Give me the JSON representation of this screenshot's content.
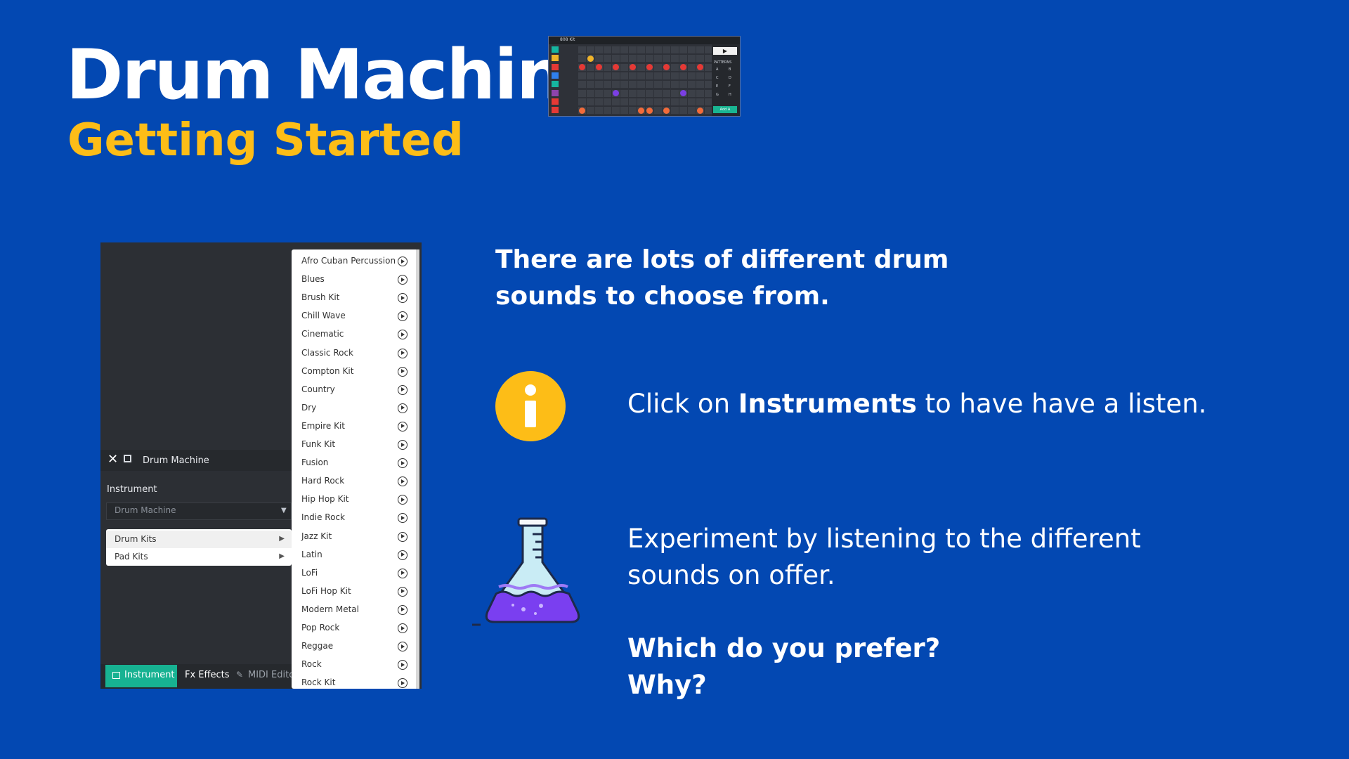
{
  "header": {
    "title": "Drum Machine",
    "subtitle": "Getting Started"
  },
  "thumbnail": {
    "kit_label": "808 Kit",
    "play_glyph": "▶",
    "patterns_label": "PATTERNS",
    "pattern_letters": [
      "A",
      "B",
      "C",
      "D",
      "E",
      "F",
      "G",
      "H"
    ],
    "add_label": "Add A"
  },
  "panel": {
    "close_glyph": "✕",
    "header_title": "Drum Machine",
    "instrument_label": "Instrument",
    "instrument_value": "Drum Machine",
    "select_chevron": "▼",
    "submenu": [
      {
        "label": "Drum Kits",
        "arrow": "▶"
      },
      {
        "label": "Pad Kits",
        "arrow": "▶"
      }
    ],
    "tabs": {
      "instrument": "Instrument",
      "effects": "Fx Effects",
      "midi": "MIDI Editor",
      "midi_icon": "✎"
    },
    "kits": [
      "Afro Cuban Percussion",
      "Blues",
      "Brush Kit",
      "Chill Wave",
      "Cinematic",
      "Classic Rock",
      "Compton Kit",
      "Country",
      "Dry",
      "Empire Kit",
      "Funk Kit",
      "Fusion",
      "Hard Rock",
      "Hip Hop Kit",
      "Indie Rock",
      "Jazz Kit",
      "Latin",
      "LoFi",
      "LoFi Hop Kit",
      "Modern Metal",
      "Pop Rock",
      "Reggae",
      "Rock",
      "Rock Kit"
    ]
  },
  "text": {
    "intro_line1": "There are lots of different drum",
    "intro_line2": "sounds to choose from.",
    "click_prefix": "Click on ",
    "click_bold": "Instruments",
    "click_suffix": " to have have a listen.",
    "experiment_line1": "Experiment by listening to the different",
    "experiment_line2": "sounds on offer.",
    "question1": "Which do you prefer?",
    "question2": "Why?"
  },
  "colors": {
    "background": "#0348b2",
    "accent_yellow": "#fdbd17",
    "panel": "#2c2f34",
    "instrument_tab": "#17b292"
  },
  "icons": [
    "info-icon",
    "flask-icon",
    "play-circle-icon",
    "close-icon",
    "fullscreen-icon"
  ]
}
